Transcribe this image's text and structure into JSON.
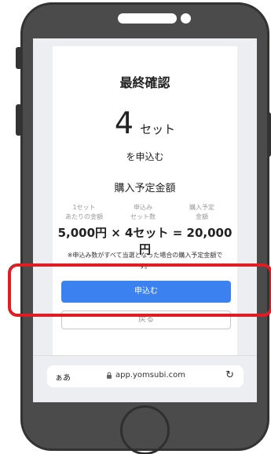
{
  "page": {
    "title": "最終確認",
    "quantity": "4",
    "quantity_unit": "セット",
    "apply_text": "を申込む",
    "expected_title": "購入予定金額",
    "columns": [
      {
        "line1": "1セット",
        "line2": "あたりの金額"
      },
      {
        "line1": "申込み",
        "line2": "セット数"
      },
      {
        "line1": "購入予定",
        "line2": "金額"
      }
    ],
    "formula": "5,000円 × 4セット = 20,000円",
    "note": "※申込み数がすべて当選となった場合の購入予定金額です。",
    "apply_button": "申込む",
    "back_button": "戻る"
  },
  "browser": {
    "aa": "ぁあ",
    "url": "app.yomsubi.com",
    "reload_icon": "↻"
  },
  "colors": {
    "primary": "#3b82f0",
    "highlight": "#e11d24",
    "phone_body": "#4b4b4b"
  }
}
